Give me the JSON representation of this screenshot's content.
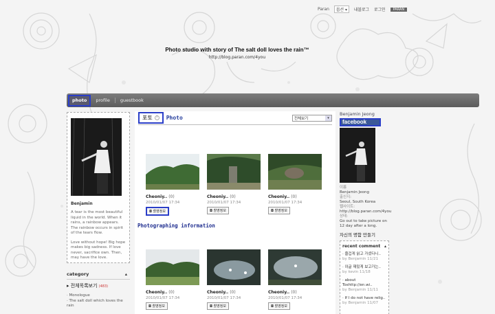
{
  "header": {
    "toplinks": [
      "Paran",
      "옵션목록",
      "내블로그",
      "로그인"
    ],
    "option_label": "옵션",
    "logo_text": "PARAN",
    "blog_title": "Photo studio with story of The salt doll loves the rain™",
    "blog_url": "http://blog.paran.com/4you"
  },
  "nav": {
    "items": [
      {
        "label": "photo",
        "active": true
      },
      {
        "label": "profile",
        "active": false
      },
      {
        "label": "guestbook",
        "active": false
      }
    ]
  },
  "left": {
    "name": "Benjamin",
    "desc1": "A tear is the most beautiful liquid in the world. When it rains, a rainbow appears. The rainbow occurs in spirit of the tears flow.",
    "desc2": "Love without hope! Big hope makes big sadness. If love never, sacrifice own. Then, may have the love.",
    "category_title": "category",
    "category_all": "전체목록보기",
    "category_all_count": "(483)",
    "category_item": "· Monologue",
    "category_item2": "· The salt doll which loves the rain"
  },
  "center": {
    "korean_title": "포토",
    "help": "?",
    "photo_title": "Photo",
    "select_value": "전체보기",
    "caption": "Photographing information",
    "info_btn": "촬영정보",
    "thumbs": [
      {
        "name": "Cheoniy..",
        "count": "(0)",
        "date": "2010/01/07 17:34"
      },
      {
        "name": "Cheoniy..",
        "count": "(0)",
        "date": "2010/01/07 17:34"
      },
      {
        "name": "Cheoniy..",
        "count": "(0)",
        "date": "2010/01/07 17:34"
      },
      {
        "name": "Cheoniy..",
        "count": "(0)",
        "date": "2010/01/07 17:34"
      },
      {
        "name": "Cheoniy..",
        "count": "(0)",
        "date": "2010/01/07 17:34"
      },
      {
        "name": "Cheoniy..",
        "count": "(0)",
        "date": "2010/01/07 17:34"
      }
    ]
  },
  "right": {
    "name": "Benjamin Jeong",
    "facebook": "facebook",
    "name_label": "이름",
    "name_value": "Benjamin Jeong",
    "location_label": "출신지:",
    "location_value": "Seoul, South Korea",
    "web_label": "웹사이트:",
    "web_value": "http://blog.paran.com/4you",
    "status": "Go out to take picture on 12 day after a long.",
    "badge_link": "자신의 명함 만들기",
    "recent_title": "recent comment",
    "comments": [
      {
        "text": "· 즐겁게 읽고 가셨다니..",
        "by": "by Benjamin 11/21"
      },
      {
        "text": "· 이글 재밌게 보고가는..",
        "by": "by kevin 11/18"
      },
      {
        "text": "· about Toshttp://en.wi..",
        "by": "by Benjamin 11/11"
      },
      {
        "text": "· If I do not have relig..",
        "by": "by Benjamin 11/07"
      }
    ]
  }
}
